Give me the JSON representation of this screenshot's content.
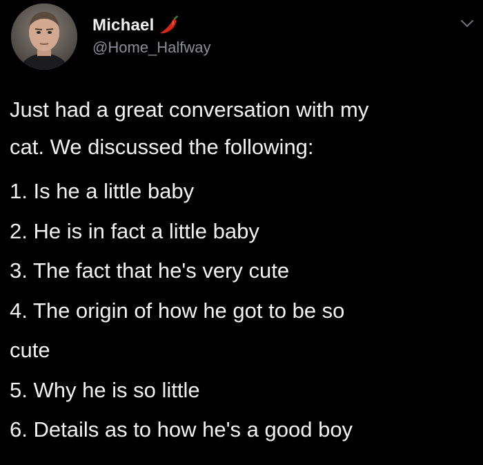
{
  "tweet": {
    "author": {
      "display_name": "Michael",
      "name_emoji": "pepper-icon",
      "handle": "@Home_Halfway",
      "avatar": "avatar"
    },
    "menu_icon": "chevron-down-icon",
    "intro_line_1": "Just had a great conversation with my",
    "intro_line_2": "cat. We discussed the following:",
    "items": [
      "1. Is he a little baby",
      "2. He is in fact a little baby",
      "3. The fact that he's very cute",
      "4. The origin of how he got to be so",
      "cute",
      "5. Why he is so little",
      "6. Details as to how he's a good boy"
    ]
  },
  "colors": {
    "background": "#000000",
    "text": "#f2f2f2",
    "handle": "#8a8f95",
    "pepper": "#d8261c"
  }
}
